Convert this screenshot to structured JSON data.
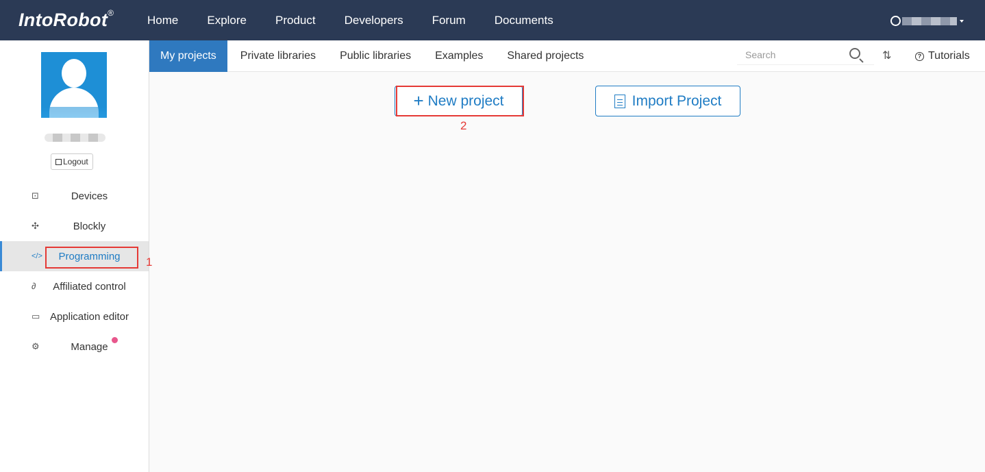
{
  "header": {
    "brand": "IntoRobot",
    "brand_mark": "®",
    "nav": [
      "Home",
      "Explore",
      "Product",
      "Developers",
      "Forum",
      "Documents"
    ]
  },
  "sidebar": {
    "logout_label": "Logout",
    "items": [
      {
        "label": "Devices",
        "icon": "chart-icon",
        "glyph": "⊡"
      },
      {
        "label": "Blockly",
        "icon": "puzzle-icon",
        "glyph": "✣"
      },
      {
        "label": "Programming",
        "icon": "code-icon",
        "glyph": "</>"
      },
      {
        "label": "Affiliated control",
        "icon": "link-icon",
        "glyph": "∂"
      },
      {
        "label": "Application editor",
        "icon": "window-icon",
        "glyph": "▭"
      },
      {
        "label": "Manage",
        "icon": "gear-icon",
        "glyph": "⚙"
      }
    ],
    "active_index": 2
  },
  "tabs": [
    "My projects",
    "Private libraries",
    "Public libraries",
    "Examples",
    "Shared projects"
  ],
  "search": {
    "placeholder": "Search"
  },
  "tutorials_label": "Tutorials",
  "actions": {
    "new_project": "New project",
    "import_project": "Import Project"
  },
  "annotations": {
    "first": "1",
    "second": "2"
  },
  "colors": {
    "topbar": "#2b3a55",
    "accent": "#1f7cc4",
    "annotation": "#e53935"
  }
}
